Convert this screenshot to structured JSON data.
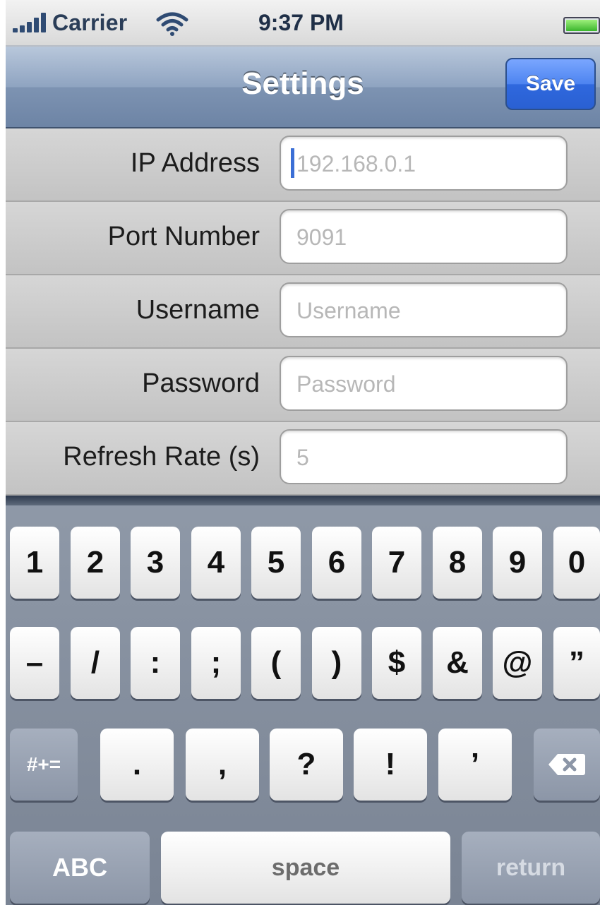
{
  "status_bar": {
    "carrier": "Carrier",
    "time": "9:37 PM",
    "icons": [
      "signal-icon",
      "wifi-icon",
      "battery-icon"
    ]
  },
  "nav_bar": {
    "title": "Settings",
    "save_label": "Save"
  },
  "form": {
    "rows": [
      {
        "label": "IP Address",
        "placeholder": "192.168.0.1",
        "focused": true
      },
      {
        "label": "Port Number",
        "placeholder": "9091"
      },
      {
        "label": "Username",
        "placeholder": "Username"
      },
      {
        "label": "Password",
        "placeholder": "Password"
      },
      {
        "label": "Refresh Rate (s)",
        "placeholder": "5"
      }
    ]
  },
  "keyboard": {
    "row1": [
      "1",
      "2",
      "3",
      "4",
      "5",
      "6",
      "7",
      "8",
      "9",
      "0"
    ],
    "row2": [
      "–",
      "/",
      ":",
      ";",
      "(",
      ")",
      "$",
      "&",
      "@",
      "”"
    ],
    "row3": {
      "symbols_label": "#+=",
      "keys": [
        ".",
        ",",
        "?",
        "!",
        "’"
      ]
    },
    "row4": {
      "abc_label": "ABC",
      "space_label": "space",
      "return_label": "return"
    }
  },
  "colors": {
    "nav_accent": "#7d93b2",
    "save_button": "#2f68de",
    "cursor": "#3b6fd6"
  }
}
